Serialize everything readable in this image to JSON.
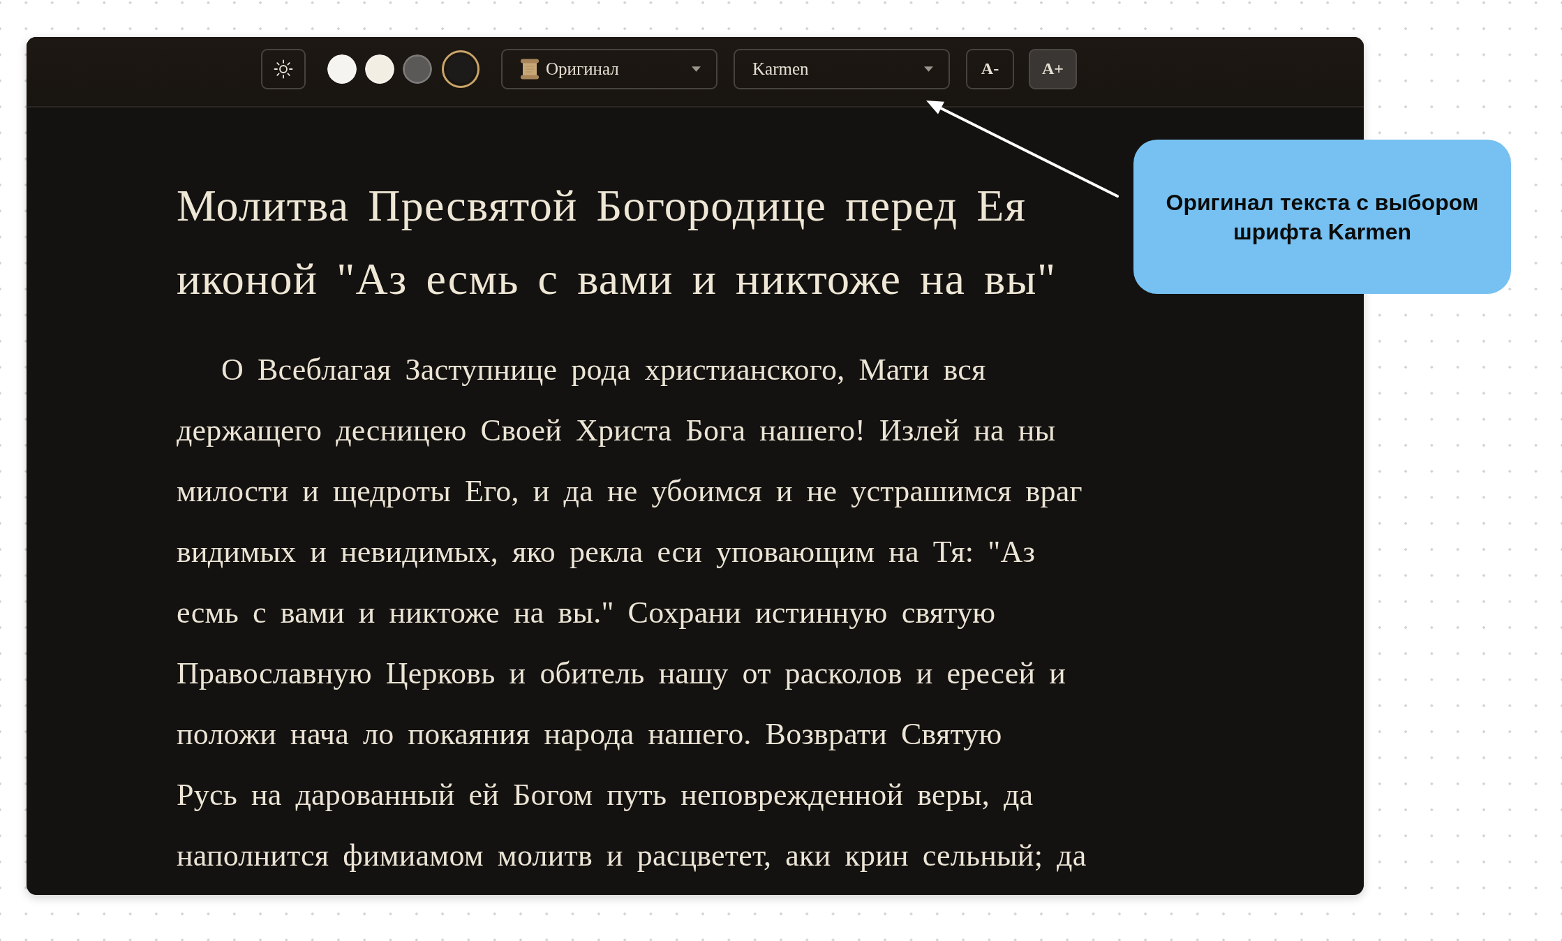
{
  "toolbar": {
    "themes": [
      {
        "color": "#f6f4f0",
        "selected": false
      },
      {
        "color": "#f3eee4",
        "selected": false
      },
      {
        "color": "#5b5957",
        "selected": false
      },
      {
        "color": "#1d1b19",
        "selected": true
      }
    ],
    "edition_select": {
      "value": "Оригинал"
    },
    "font_select": {
      "value": "Karmen"
    },
    "size_buttons": [
      {
        "label": "A-",
        "active": false
      },
      {
        "label": "A+",
        "active": true
      }
    ]
  },
  "reader": {
    "title": "Молитва Пресвятой Богородице перед Ея иконой \"Аз есмь с вами и никтоже на вы\"",
    "paragraph_lines": [
      "О Всеблагая Заступнице рода христианского, Мати вся",
      "держащего десницею Своей Христа Бога нашего! Излей на ны",
      "милости и щедроты Его, и да не убоимся и не устрашимся враг",
      "видимых и невидимых, яко рекла еси уповающим на Тя: \"Аз",
      "есмь с вами и никтоже на вы.\" Сохрани истинную святую",
      "Православную Церковь и обитель нашу от расколов и ересей и",
      "положи нача ло покаяния народа нашего. Возврати Святую",
      "Русь на дарованный ей Богом путь неповрежденной веры, да",
      "наполнится фимиамом молитв и расцветет, аки крин сельный; да"
    ]
  },
  "callout": {
    "text": "Оригинал текста с выбором шрифта Karmen"
  }
}
